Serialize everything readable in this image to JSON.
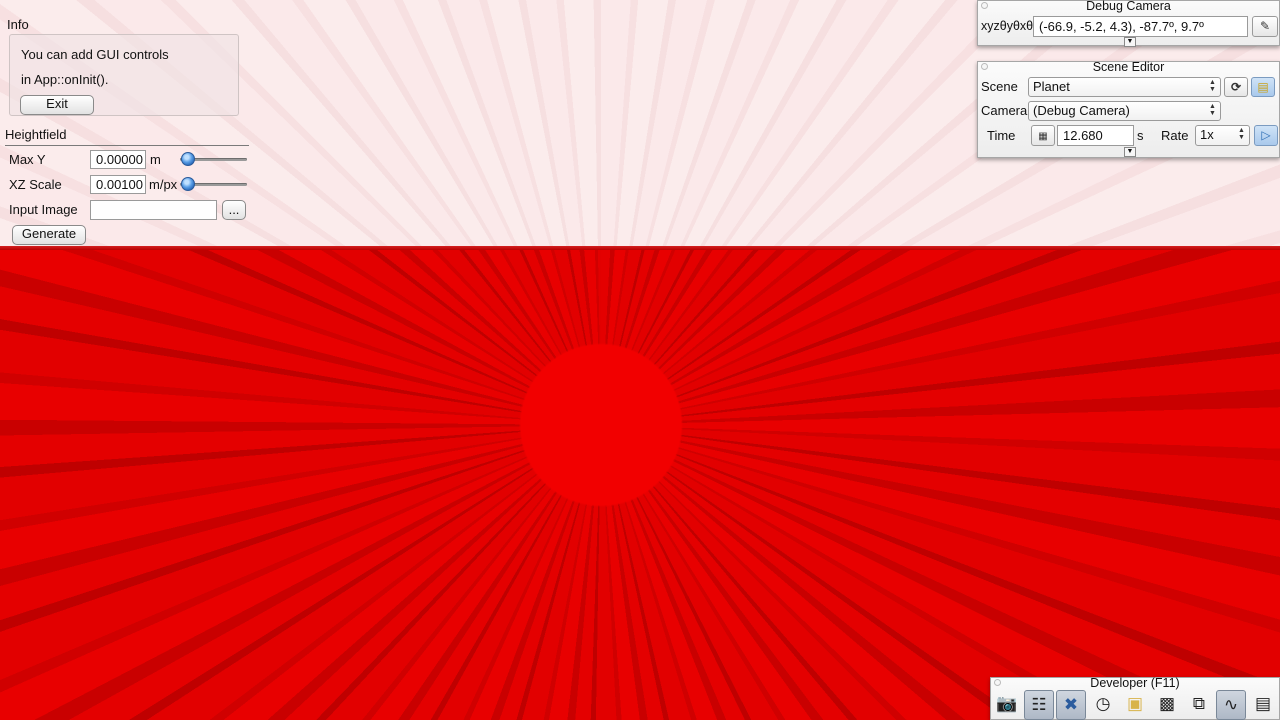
{
  "app_panel": {
    "info_title": "Info",
    "info_line1": "You can add GUI controls",
    "info_line2": "in App::onInit().",
    "exit_label": "Exit",
    "heightfield_title": "Heightfield",
    "max_y": {
      "label": "Max Y",
      "value": "0.00000",
      "unit": "m",
      "slider_fraction": 0.05
    },
    "xz_scale": {
      "label": "XZ Scale",
      "value": "0.00100",
      "unit": "m/px",
      "slider_fraction": 0.05
    },
    "input_image": {
      "label": "Input Image",
      "value": "",
      "browse_label": "..."
    },
    "generate_label": "Generate"
  },
  "debug_camera": {
    "title": "Debug Camera",
    "coord_label": "xyzθyθxθz",
    "coords_value": "(-66.9,  -5.2,   4.3), -87.7º,   9.7º",
    "collapse_icon": "triangle-down-icon"
  },
  "scene_editor": {
    "title": "Scene Editor",
    "scene_label": "Scene",
    "scene_value": "Planet",
    "camera_label": "Camera",
    "camera_value": "(Debug Camera)",
    "time_label": "Time",
    "time_value": "12.680",
    "time_unit": "s",
    "rate_label": "Rate",
    "rate_value": "1x"
  },
  "developer": {
    "title": "Developer (F11)",
    "tools": [
      "camera-icon",
      "clapperboard-icon",
      "tools-icon",
      "clock-icon",
      "note-icon",
      "terminal-icon",
      "windows-icon",
      "graph-icon",
      "document-icon"
    ]
  },
  "colors": {
    "ground": "#e00000",
    "sky": "#fbe8e9",
    "slider_knob": "#3c82d4",
    "active_button": "#a9c9ec"
  }
}
